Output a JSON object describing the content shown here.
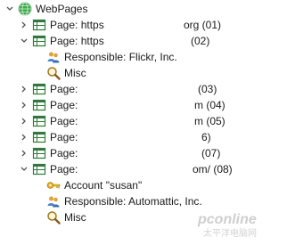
{
  "tree": {
    "root": {
      "label": "WebPages",
      "icon": "globe-icon"
    },
    "items": [
      {
        "label": "Page: https",
        "suffix": "org (01)",
        "icon": "table-icon",
        "expanded": false
      },
      {
        "label": "Page: https",
        "suffix": "(02)",
        "icon": "table-icon",
        "expanded": true,
        "children": [
          {
            "label": "Responsible: Flickr, Inc.",
            "icon": "user-group-icon"
          },
          {
            "label": "Misc",
            "icon": "magnifier-icon"
          }
        ]
      },
      {
        "label": "Page:",
        "suffix": "(03)",
        "icon": "table-icon",
        "expanded": false
      },
      {
        "label": "Page:",
        "suffix": "m (04)",
        "icon": "table-icon",
        "expanded": false
      },
      {
        "label": "Page:",
        "suffix": "m (05)",
        "icon": "table-icon",
        "expanded": false
      },
      {
        "label": "Page:",
        "suffix": "6)",
        "icon": "table-icon",
        "expanded": false
      },
      {
        "label": "Page:",
        "suffix": "(07)",
        "icon": "table-icon",
        "expanded": false
      },
      {
        "label": "Page:",
        "suffix": "om/ (08)",
        "icon": "table-icon",
        "expanded": true,
        "children": [
          {
            "label": "Account \"susan\"",
            "icon": "key-icon"
          },
          {
            "label": "Responsible: Automattic, Inc.",
            "icon": "user-group-icon"
          },
          {
            "label": "Misc",
            "icon": "magnifier-icon"
          }
        ]
      }
    ]
  },
  "watermark": {
    "text": "pconline",
    "subtext": "太平洋电脑网",
    "color": "#c9c9c9"
  },
  "colors": {
    "text": "#1a1a1a",
    "chevron": "#555555",
    "globe": "#3aa84a",
    "table": "#2d7a3a",
    "key": "#d9a520"
  }
}
